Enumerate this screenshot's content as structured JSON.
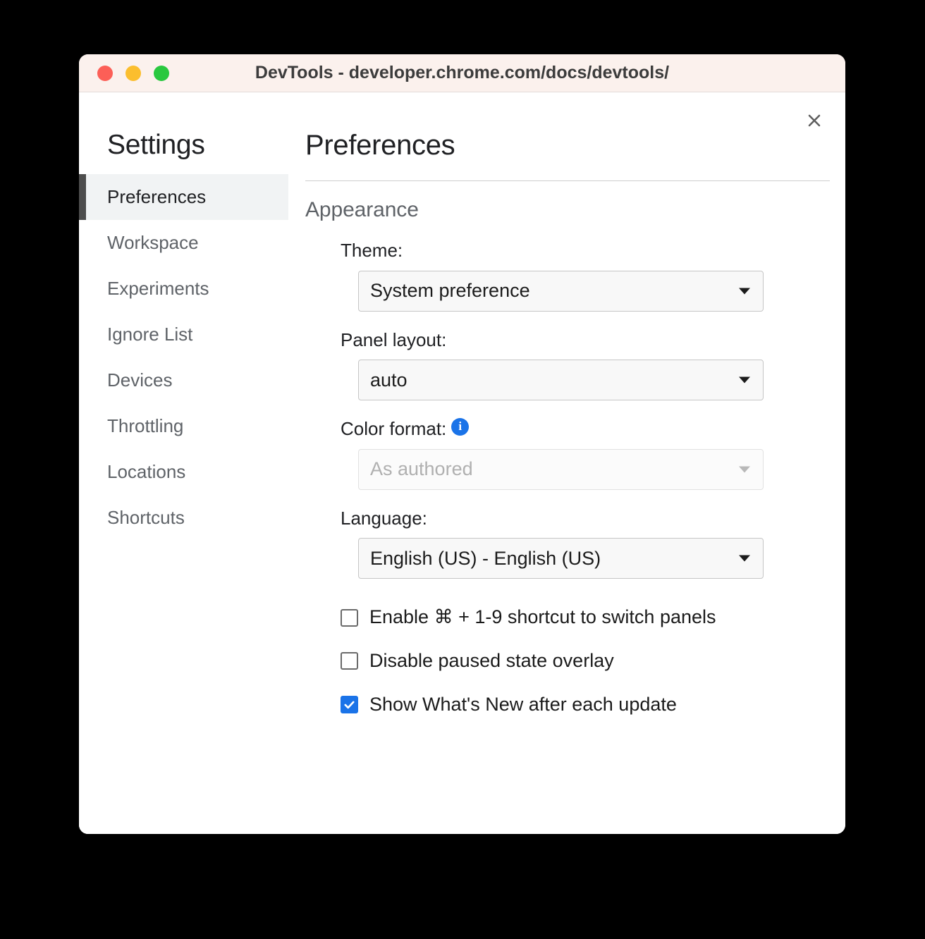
{
  "window": {
    "title": "DevTools - developer.chrome.com/docs/devtools/",
    "traffic_lights": [
      {
        "name": "close",
        "color": "#fc5f57"
      },
      {
        "name": "minimize",
        "color": "#fbbe2e"
      },
      {
        "name": "maximize",
        "color": "#29c83f"
      }
    ]
  },
  "dialog": {
    "close_icon": "close-icon"
  },
  "sidebar": {
    "title": "Settings",
    "items": [
      {
        "label": "Preferences",
        "selected": true
      },
      {
        "label": "Workspace",
        "selected": false
      },
      {
        "label": "Experiments",
        "selected": false
      },
      {
        "label": "Ignore List",
        "selected": false
      },
      {
        "label": "Devices",
        "selected": false
      },
      {
        "label": "Throttling",
        "selected": false
      },
      {
        "label": "Locations",
        "selected": false
      },
      {
        "label": "Shortcuts",
        "selected": false
      }
    ]
  },
  "main": {
    "title": "Preferences",
    "section": {
      "heading": "Appearance",
      "fields": [
        {
          "label": "Theme:",
          "value": "System preference",
          "disabled": false,
          "info": false
        },
        {
          "label": "Panel layout:",
          "value": "auto",
          "disabled": false,
          "info": false
        },
        {
          "label": "Color format:",
          "value": "As authored",
          "disabled": true,
          "info": true,
          "info_icon": "info-icon"
        },
        {
          "label": "Language:",
          "value": "English (US) - English (US)",
          "disabled": false,
          "info": false
        }
      ],
      "checkboxes": [
        {
          "label": "Enable ⌘ + 1-9 shortcut to switch panels",
          "checked": false
        },
        {
          "label": "Disable paused state overlay",
          "checked": false
        },
        {
          "label": "Show What's New after each update",
          "checked": true
        }
      ]
    }
  },
  "colors": {
    "accent_blue": "#1a73e8",
    "titlebar_bg": "#fbf1ed",
    "selected_nav_bg": "#f1f3f4",
    "selected_nav_marker": "#4d4d4d",
    "text_primary": "#202124",
    "text_secondary": "#5f6368"
  }
}
